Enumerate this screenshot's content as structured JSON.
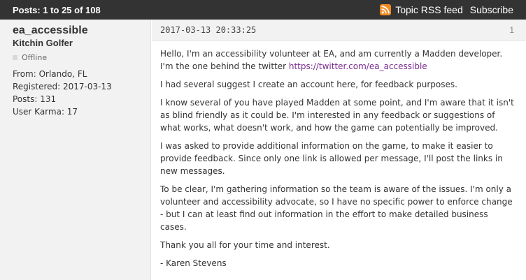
{
  "topbar": {
    "posts_count": "Posts: 1 to 25 of 108",
    "rss_label": "Topic RSS feed",
    "subscribe_label": "Subscribe",
    "icons": {
      "rss": "rss-icon"
    },
    "colors": {
      "bar": "#333333",
      "rss": "#f28a22"
    }
  },
  "author": {
    "username": "ea_accessible",
    "title": "Kitchin Golfer",
    "status": "Offline",
    "from": "From: Orlando, FL",
    "registered": "Registered: 2017-03-13",
    "posts": "Posts: 131",
    "karma": "User Karma: 17"
  },
  "post": {
    "timestamp": "2017-03-13 20:33:25",
    "number": "1",
    "p1_text": "Hello, I'm an accessibility volunteer at EA, and am currently a Madden developer. I'm the one behind the twitter ",
    "p1_link": "https://twitter.com/ea_accessible",
    "p2": "I had several suggest I create an account here, for feedback purposes.",
    "p3": "I know several of you have played Madden at some point, and I'm aware that it isn't as blind friendly as it could be. I'm interested in any feedback or suggestions of what works, what doesn't work, and how the game can potentially be improved.",
    "p4": "I was asked to provide additional information on the game, to make it easier to provide feedback.  Since only one link is allowed per message, I'll post the links in new messages.",
    "p5": "To be clear, I'm gathering information so the team is aware of the issues. I'm only a volunteer and accessibility advocate, so I have no specific power to enforce change - but I can at least find out information in the effort to make detailed business cases.",
    "p6": "Thank you all for your time and interest.",
    "signature": "- Karen Stevens",
    "link_color": "#7a2b8f"
  }
}
